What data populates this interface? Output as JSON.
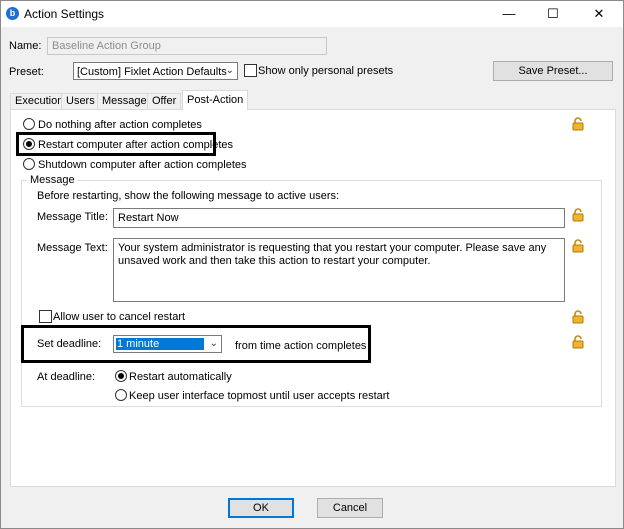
{
  "window": {
    "title": "Action Settings",
    "controls": {
      "minimize": "—",
      "maximize": "☐",
      "close": "✕"
    }
  },
  "name_row": {
    "label": "Name:",
    "value": "Baseline Action Group"
  },
  "preset_row": {
    "label": "Preset:",
    "selected": "[Custom] Fixlet Action Defaults",
    "personal_label": "Show only personal presets",
    "save_button": "Save Preset..."
  },
  "tabs": [
    {
      "label": "Execution"
    },
    {
      "label": "Users"
    },
    {
      "label": "Messages"
    },
    {
      "label": "Offer"
    },
    {
      "label": "Post-Action"
    }
  ],
  "post_action": {
    "options": [
      {
        "label": "Do nothing after action completes",
        "selected": false
      },
      {
        "label": "Restart computer after action completes",
        "selected": true
      },
      {
        "label": "Shutdown computer after action completes",
        "selected": false
      }
    ],
    "message_group": {
      "title": "Message",
      "intro": "Before restarting, show the following message to active users:",
      "title_label": "Message Title:",
      "title_value": "Restart Now",
      "text_label": "Message Text:",
      "text_value": "Your system administrator is requesting that you restart your computer.  Please save any unsaved work and then take this action to restart your computer.",
      "allow_cancel_label": "Allow user to cancel restart",
      "deadline_label": "Set deadline:",
      "deadline_value": "1 minute",
      "deadline_suffix": "from time action completes",
      "at_deadline_label": "At deadline:",
      "at_deadline_options": [
        {
          "label": "Restart automatically",
          "selected": true
        },
        {
          "label": "Keep user interface topmost until user accepts restart",
          "selected": false
        }
      ]
    }
  },
  "footer": {
    "ok": "OK",
    "cancel": "Cancel"
  },
  "colors": {
    "lock": "#e8a317",
    "selection": "#0078d7",
    "accent": "#0078d7"
  }
}
